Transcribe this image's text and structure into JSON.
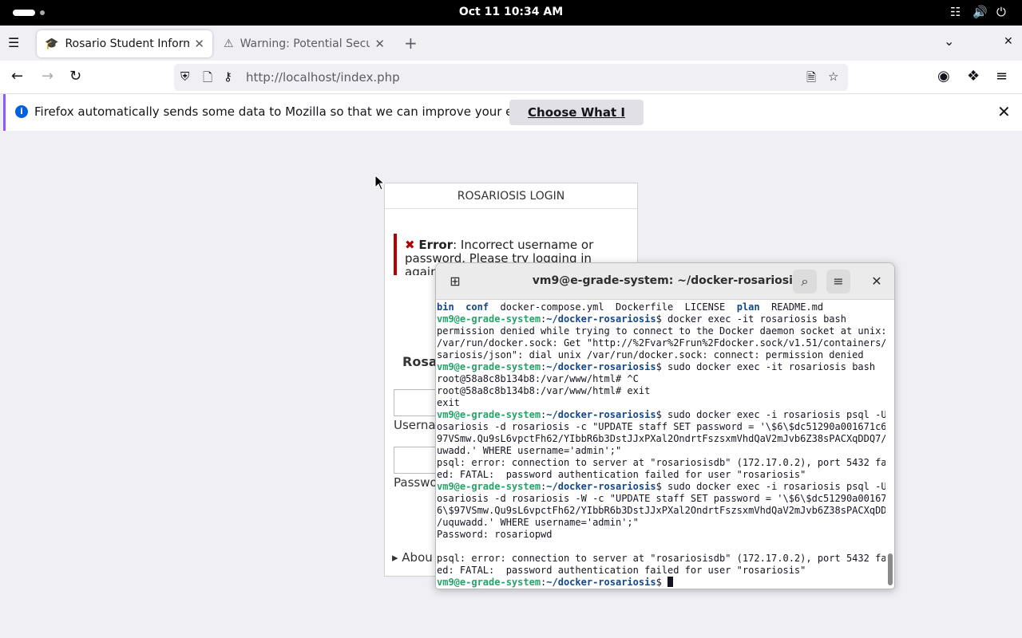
{
  "system_bar": {
    "clock": "Oct 11  10:34 AM",
    "icons": [
      "network-icon",
      "volume-icon",
      "power-icon"
    ]
  },
  "browser": {
    "tabs": [
      {
        "title": "Rosario Student Informat",
        "icon": "rosario-favicon",
        "active": true
      },
      {
        "title": "Warning: Potential Securi",
        "icon": "warning-icon",
        "active": false
      }
    ],
    "url": "http://localhost/index.php",
    "notification": {
      "message": "Firefox automatically sends some data to Mozilla so that we can improve your experience.",
      "button": "Choose What I Share"
    }
  },
  "login_page": {
    "header": "ROSARIOSIS LOGIN",
    "error_label": "Error",
    "error_text": ": Incorrect username or password. Please try logging in again.",
    "brand_partial": "Rosar",
    "username_label_partial": "Userna",
    "password_label_partial": "Passwo",
    "about_partial": "▸ Abou"
  },
  "terminal": {
    "title": "vm9@e-grade-system: ~/docker-rosariosis",
    "lines": [
      {
        "type": "ls",
        "segments": [
          [
            "bin",
            "dir"
          ],
          [
            "  ",
            ""
          ],
          [
            "conf",
            "dir"
          ],
          [
            "  docker-compose.yml  Dockerfile  LICENSE  ",
            ""
          ],
          [
            "plan",
            "dir"
          ],
          [
            "  README.md",
            ""
          ]
        ]
      },
      {
        "type": "prompt",
        "user": "vm9@e-grade-system",
        "path": "~/docker-rosariosis",
        "cmd": " docker exec -it rosariosis bash"
      },
      {
        "type": "text",
        "text": "permission denied while trying to connect to the Docker daemon socket at unix://"
      },
      {
        "type": "text",
        "text": "/var/run/docker.sock: Get \"http://%2Fvar%2Frun%2Fdocker.sock/v1.51/containers/ro"
      },
      {
        "type": "text",
        "text": "sariosis/json\": dial unix /var/run/docker.sock: connect: permission denied"
      },
      {
        "type": "prompt",
        "user": "vm9@e-grade-system",
        "path": "~/docker-rosariosis",
        "cmd": " sudo docker exec -it rosariosis bash"
      },
      {
        "type": "text",
        "text": "root@58a8c8b134b8:/var/www/html# ^C"
      },
      {
        "type": "text",
        "text": "root@58a8c8b134b8:/var/www/html# exit"
      },
      {
        "type": "text",
        "text": "exit"
      },
      {
        "type": "prompt",
        "user": "vm9@e-grade-system",
        "path": "~/docker-rosariosis",
        "cmd": " sudo docker exec -i rosariosis psql -U r"
      },
      {
        "type": "text",
        "text": "osariosis -d rosariosis -c \"UPDATE staff SET password = '\\$6\\$dc51290a001671c6\\$"
      },
      {
        "type": "text",
        "text": "97VSmw.Qu9sL6vpctFh62/YIbbR6b3DstJJxPXal2OndrtFszsxmVhdQaV2mJvb6Z38sPACXqDDQ7/uq"
      },
      {
        "type": "text",
        "text": "uwadd.' WHERE username='admin';\""
      },
      {
        "type": "text",
        "text": "psql: error: connection to server at \"rosariosisdb\" (172.17.0.2), port 5432 fail"
      },
      {
        "type": "text",
        "text": "ed: FATAL:  password authentication failed for user \"rosariosis\""
      },
      {
        "type": "prompt",
        "user": "vm9@e-grade-system",
        "path": "~/docker-rosariosis",
        "cmd": " sudo docker exec -i rosariosis psql -U r"
      },
      {
        "type": "text",
        "text": "osariosis -d rosariosis -W -c \"UPDATE staff SET password = '\\$6\\$dc51290a001671c"
      },
      {
        "type": "text",
        "text": "6\\$97VSmw.Qu9sL6vpctFh62/YIbbR6b3DstJJxPXal2OndrtFszsxmVhdQaV2mJvb6Z38sPACXqDDQ7"
      },
      {
        "type": "text",
        "text": "/uquwadd.' WHERE username='admin';\""
      },
      {
        "type": "text",
        "text": "Password: rosariopwd"
      },
      {
        "type": "text",
        "text": ""
      },
      {
        "type": "text",
        "text": "psql: error: connection to server at \"rosariosisdb\" (172.17.0.2), port 5432 fail"
      },
      {
        "type": "text",
        "text": "ed: FATAL:  password authentication failed for user \"rosariosis\""
      },
      {
        "type": "prompt",
        "user": "vm9@e-grade-system",
        "path": "~/docker-rosariosis",
        "cmd": " ",
        "cursor": true
      }
    ]
  }
}
